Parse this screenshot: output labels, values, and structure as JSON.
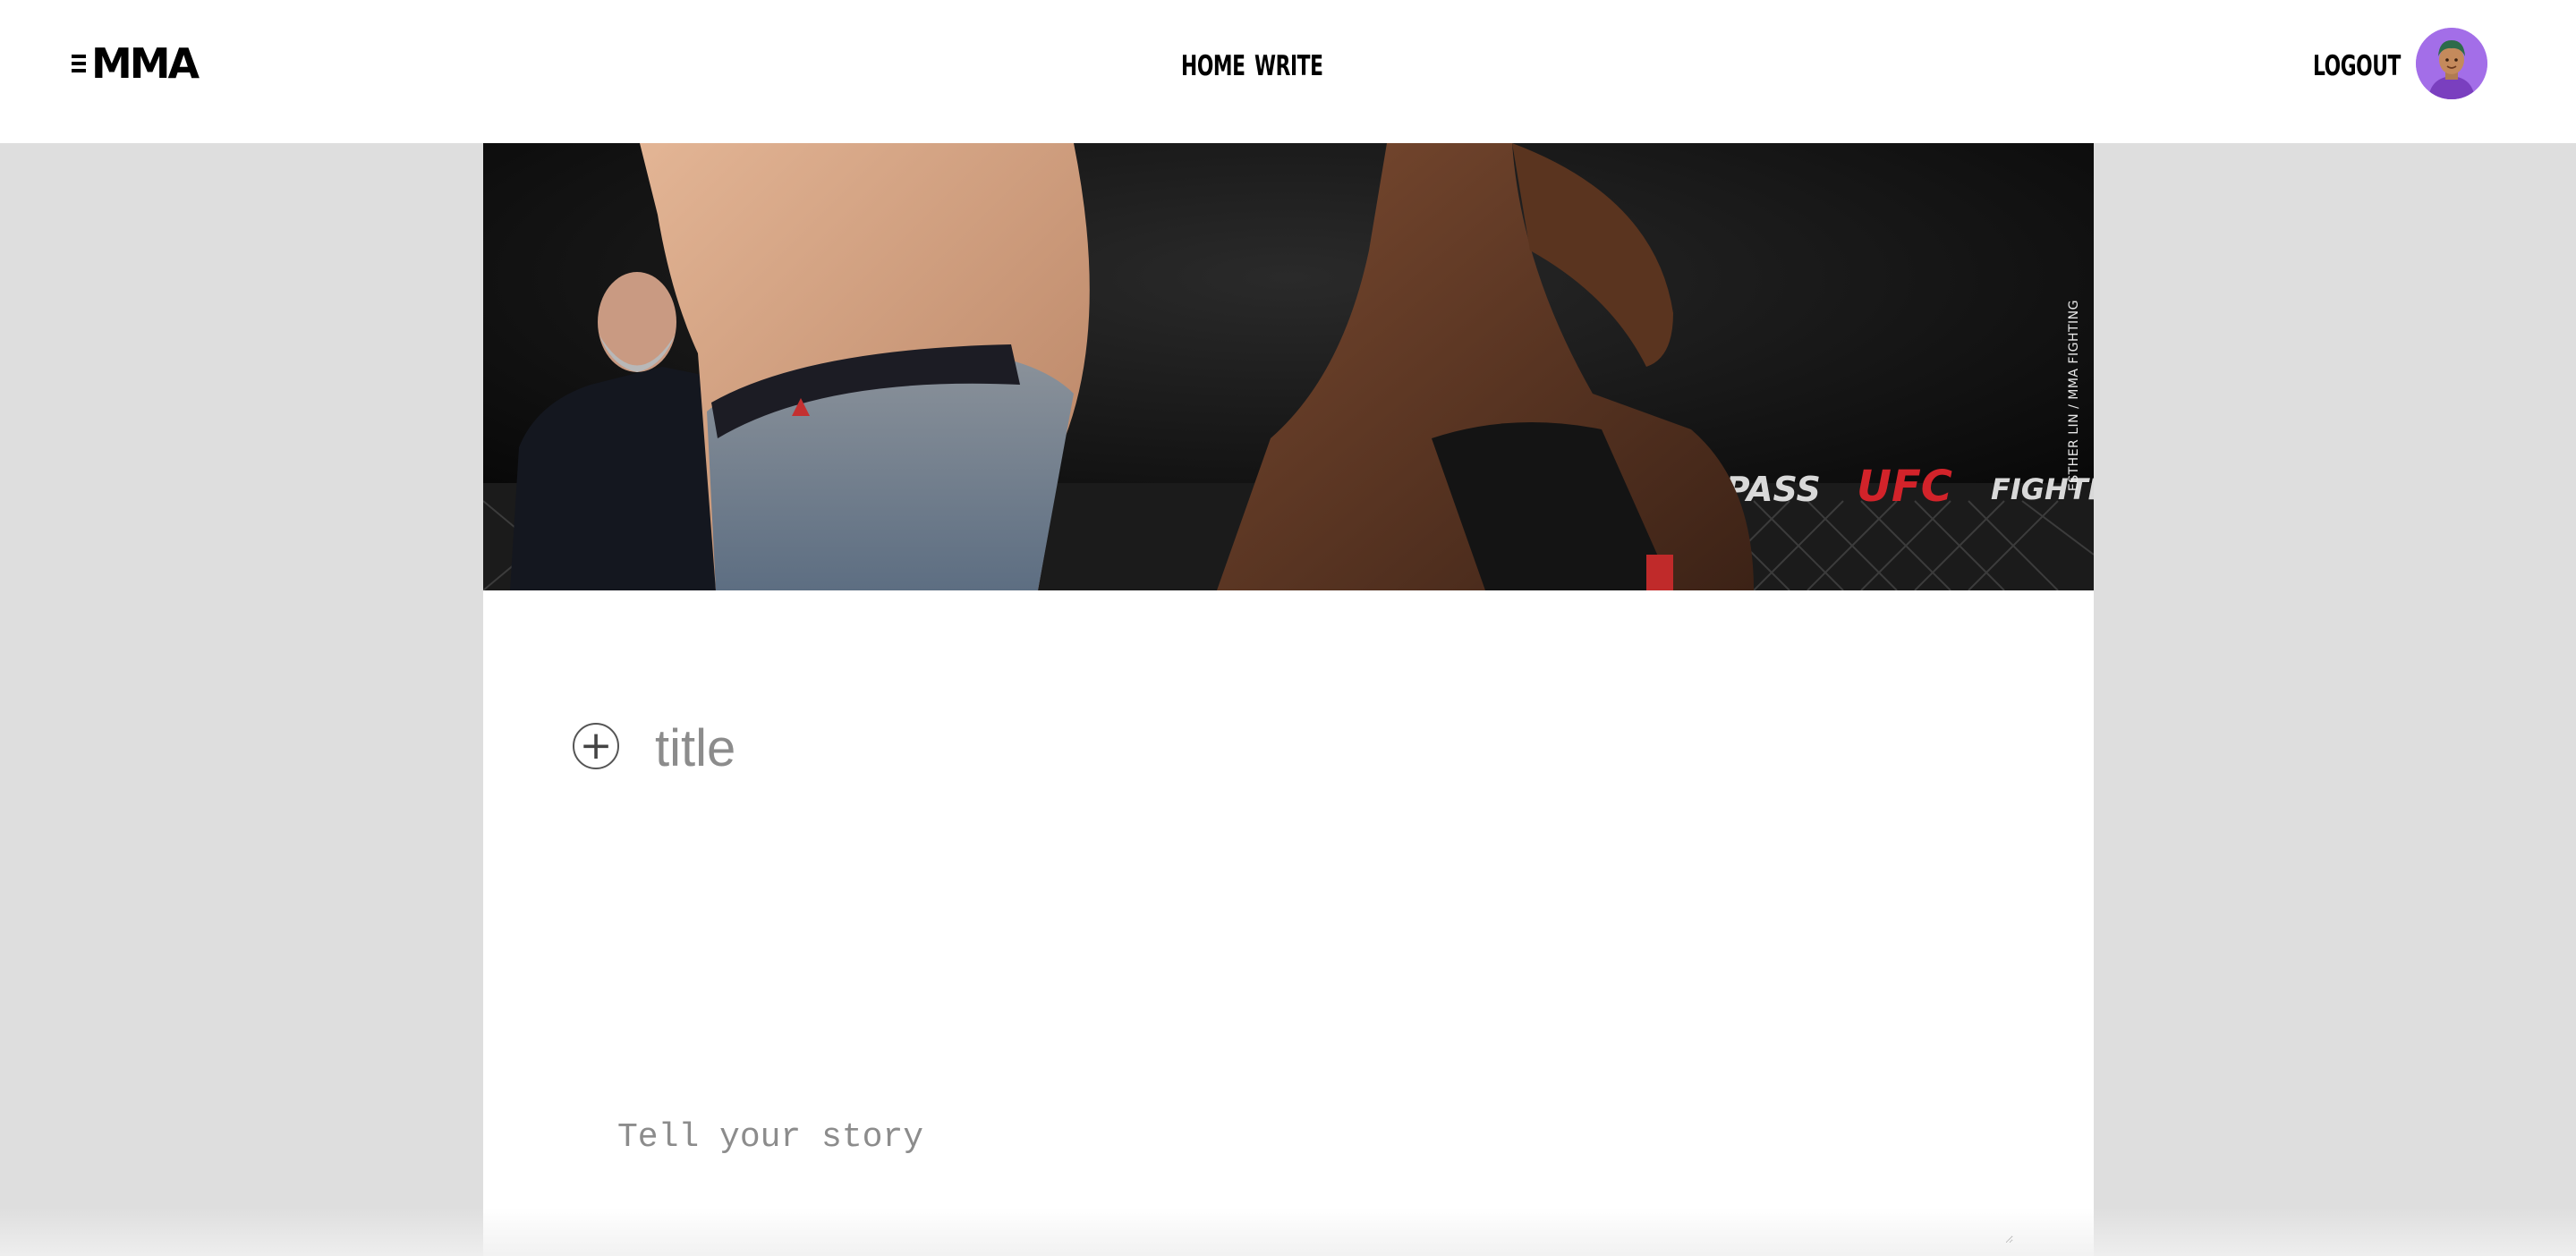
{
  "brand": {
    "logo_text": "MMA"
  },
  "nav": {
    "home_label": "HOME",
    "write_label": "WRITE",
    "logout_label": "LOGOUT"
  },
  "hero": {
    "photo_credit": "ESTHER LIN / MMA FIGHTING"
  },
  "editor": {
    "add_icon": "plus-circle-icon",
    "title_placeholder": "title",
    "story_placeholder": "Tell your story"
  },
  "colors": {
    "page_background": "#dedede",
    "avatar_background": "#a36ee8"
  }
}
